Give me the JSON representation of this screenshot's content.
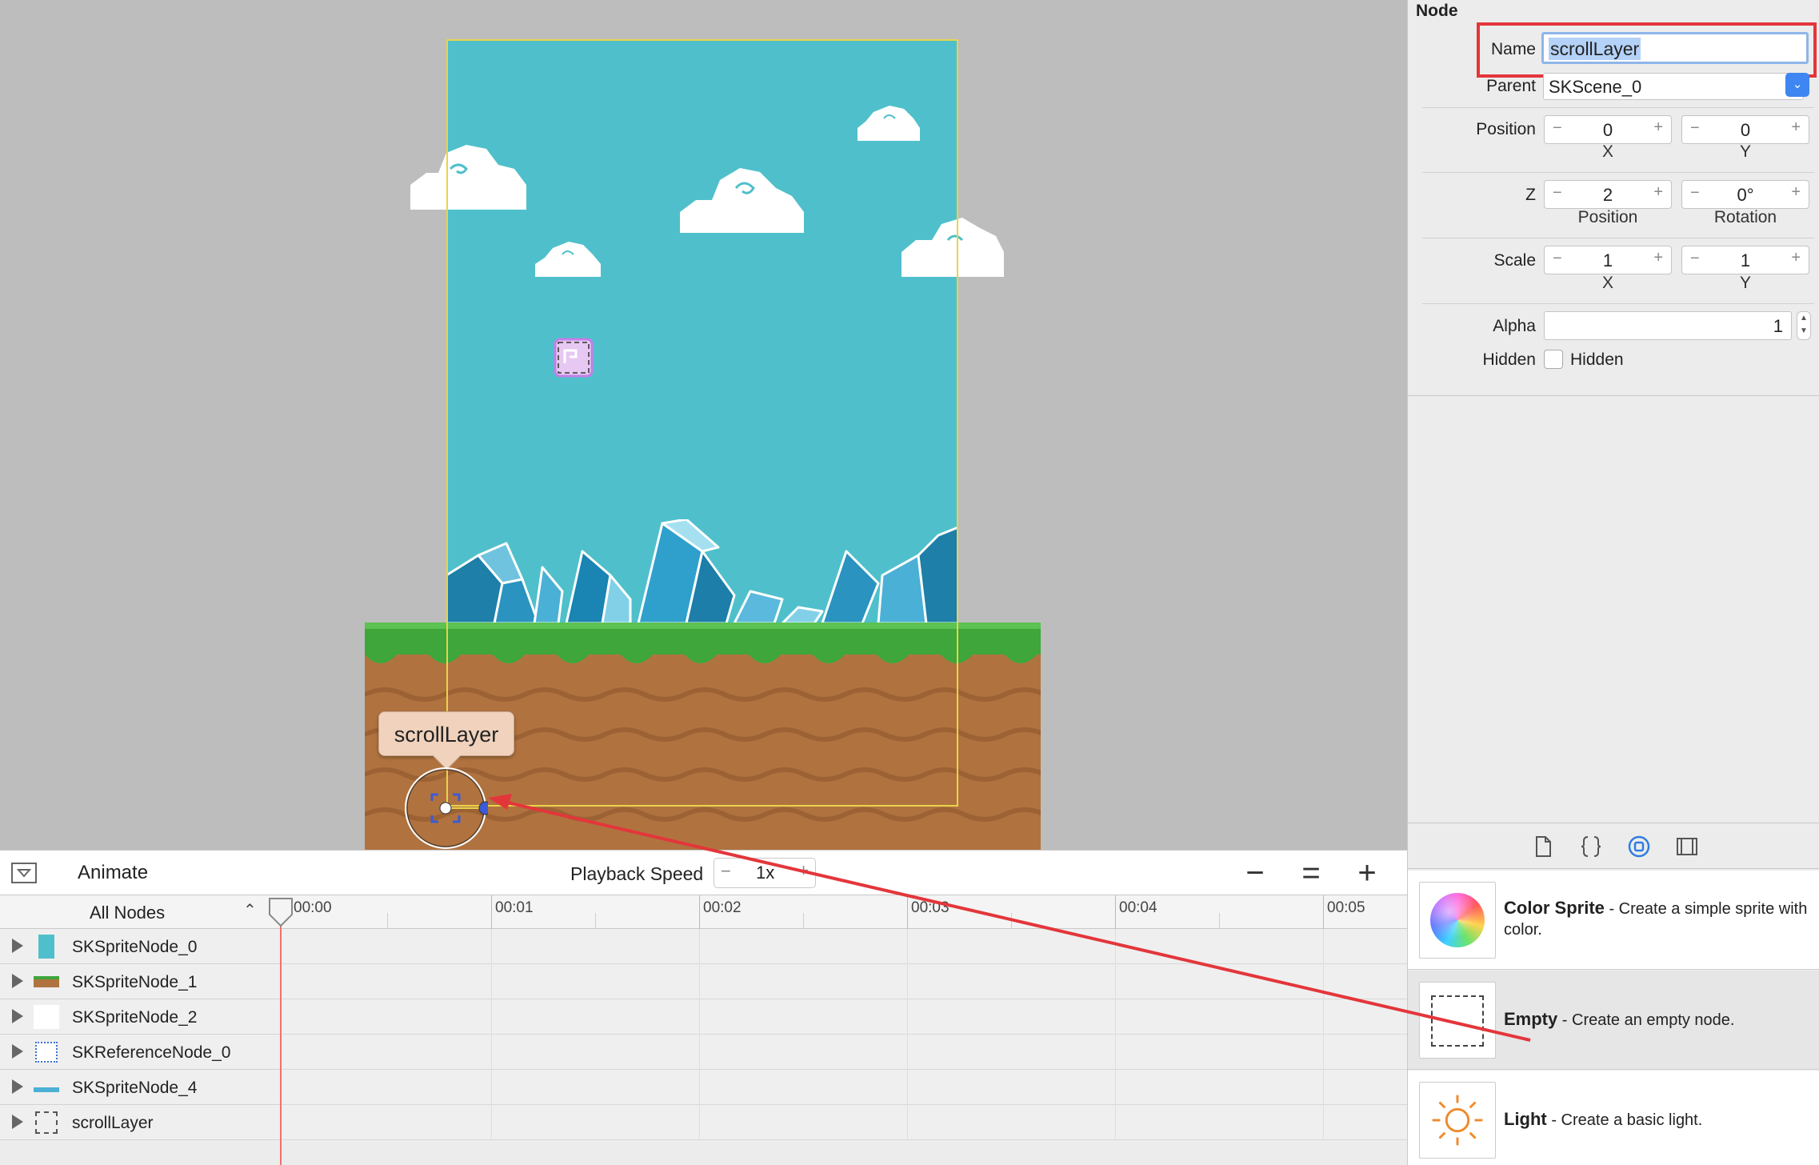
{
  "scene": {
    "tooltip_label": "scrollLayer"
  },
  "timeline": {
    "animate_label": "Animate",
    "playback_speed_label": "Playback Speed",
    "speed_value": "1x",
    "speed_minus": "−",
    "speed_plus": "+",
    "zoom_out": "−",
    "zoom_fit": "=",
    "zoom_in": "+",
    "filter_label": "All Nodes",
    "ruler_labels": [
      "00:00",
      "00:01",
      "00:02",
      "00:03",
      "00:04",
      "00:05"
    ],
    "nodes": [
      {
        "name": "SKSpriteNode_0",
        "thumb": "sky-color"
      },
      {
        "name": "SKSpriteNode_1",
        "thumb": "ground"
      },
      {
        "name": "SKSpriteNode_2",
        "thumb": "white"
      },
      {
        "name": "SKReferenceNode_0",
        "thumb": "reference-dotted"
      },
      {
        "name": "SKSpriteNode_4",
        "thumb": "crystals"
      },
      {
        "name": "scrollLayer",
        "thumb": "empty-node"
      }
    ]
  },
  "inspector": {
    "section_title": "Node",
    "name_label": "Name",
    "name_value": "scrollLayer",
    "parent_label": "Parent",
    "parent_value": "SKScene_0",
    "position_label": "Position",
    "position_x": "0",
    "position_y": "0",
    "x_label": "X",
    "y_label": "Y",
    "z_label": "Z",
    "z_position": "2",
    "rotation": "0°",
    "z_position_label": "Position",
    "rotation_label": "Rotation",
    "scale_label": "Scale",
    "scale_x": "1",
    "scale_y": "1",
    "alpha_label": "Alpha",
    "alpha_value": "1",
    "hidden_label": "Hidden",
    "hidden_checkbox_label": "Hidden",
    "stepper_minus": "−",
    "stepper_plus": "+"
  },
  "library": {
    "items": [
      {
        "title": "Color Sprite",
        "desc": " - Create a simple sprite with color."
      },
      {
        "title": "Empty",
        "desc": " - Create an empty node."
      },
      {
        "title": "Light",
        "desc": " - Create a basic light."
      }
    ]
  },
  "colors": {
    "sky": "#4fc0cb",
    "annotation": "#e3363b",
    "scene_bounds": "#e8d44a",
    "accent_blue": "#3e86f1"
  }
}
